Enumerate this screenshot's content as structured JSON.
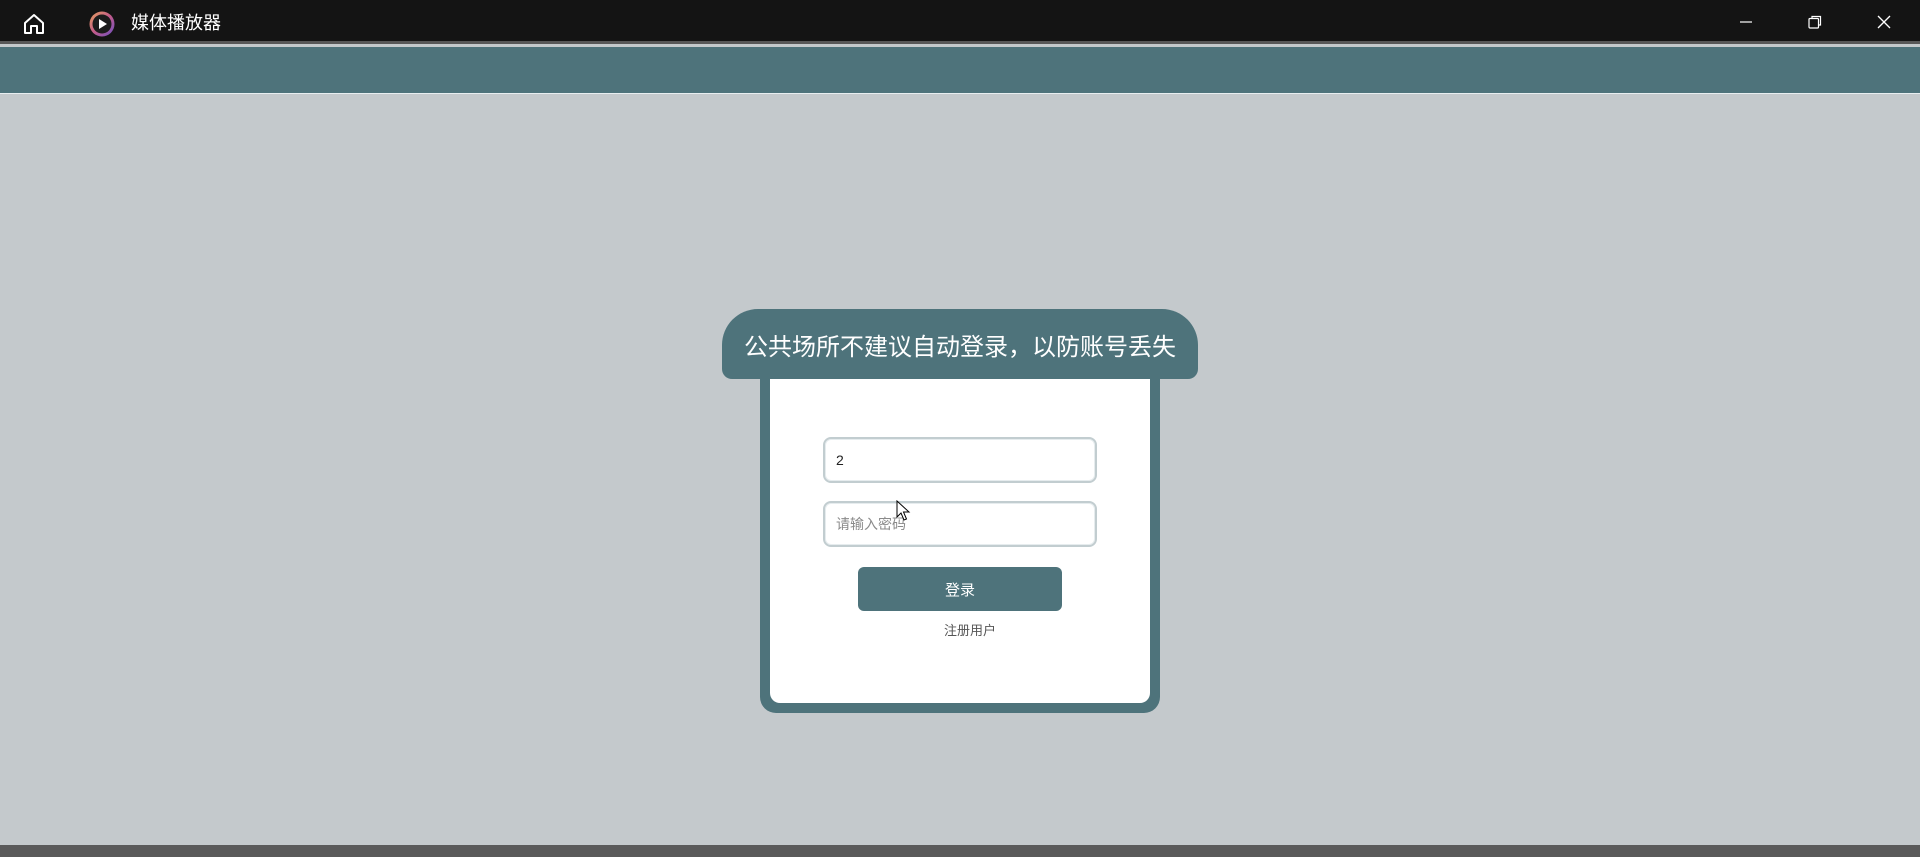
{
  "window": {
    "title": "媒体播放器",
    "icons": {
      "home": "home-icon",
      "logo": "play-logo-icon",
      "minimize": "minimize-icon",
      "restore": "restore-icon",
      "close": "close-icon"
    }
  },
  "login": {
    "notice": "公共场所不建议自动登录，以防账号丢失",
    "username_value": "2",
    "password_placeholder": "请输入密码",
    "login_label": "登录",
    "register_label": "注册用户"
  },
  "colors": {
    "accent": "#4e737b",
    "background": "#c4c9cc",
    "titlebar": "#141414"
  }
}
